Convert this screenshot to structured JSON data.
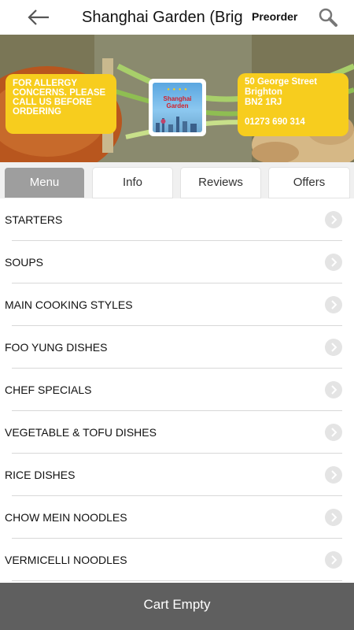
{
  "header": {
    "title": "Shanghai Garden (Brighton)",
    "preorder_label": "Preorder"
  },
  "banner": {
    "allergy_notice": "FOR ALLERGY CONCERNS. PLEASE CALL US BEFORE ORDERING",
    "address_line1": "50 George Street",
    "address_line2": "Brighton",
    "address_line3": "BN2 1RJ",
    "phone": "01273 690 314",
    "logo_text_line1": "Shanghai",
    "logo_text_line2": "Garden"
  },
  "tabs": [
    {
      "label": "Menu",
      "active": true
    },
    {
      "label": "Info",
      "active": false
    },
    {
      "label": "Reviews",
      "active": false
    },
    {
      "label": "Offers",
      "active": false
    }
  ],
  "menu": {
    "items": [
      {
        "label": "STARTERS"
      },
      {
        "label": "SOUPS"
      },
      {
        "label": "MAIN COOKING STYLES"
      },
      {
        "label": "FOO YUNG DISHES"
      },
      {
        "label": "CHEF SPECIALS"
      },
      {
        "label": "VEGETABLE & TOFU DISHES"
      },
      {
        "label": "RICE DISHES"
      },
      {
        "label": "CHOW MEIN NOODLES"
      },
      {
        "label": "VERMICELLI NOODLES"
      }
    ]
  },
  "cart": {
    "label": "Cart Empty"
  },
  "colors": {
    "accent_yellow": "#f7cd1e",
    "active_tab": "#9e9e9e",
    "cart_bar": "#5f5f5f"
  },
  "icons": {
    "back": "back-arrow-icon",
    "search": "search-icon",
    "chevron": "chevron-right-icon"
  }
}
